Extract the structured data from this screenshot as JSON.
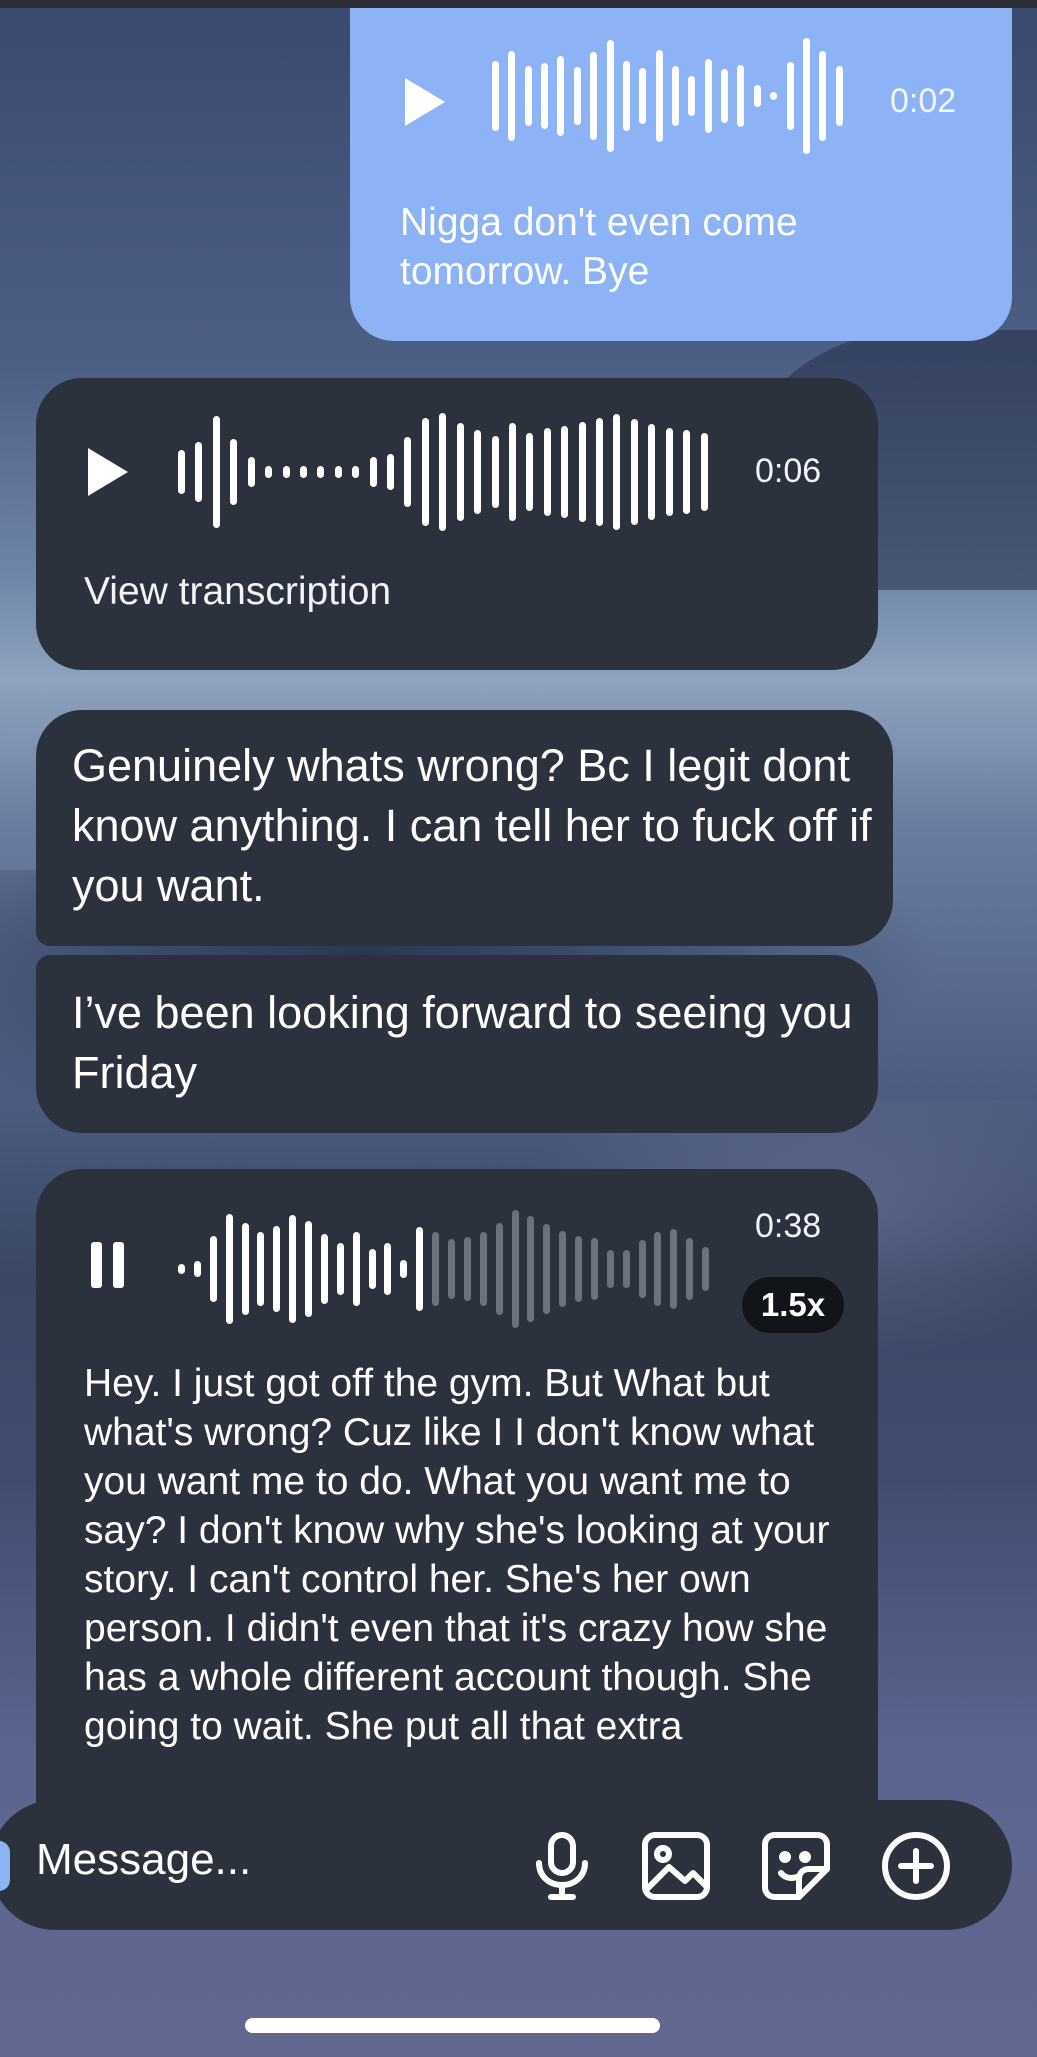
{
  "messages": [
    {
      "type": "voice",
      "direction": "outgoing",
      "duration": "0:02",
      "transcript": "Nigga don't even come tomorrow. Bye"
    },
    {
      "type": "voice",
      "direction": "incoming",
      "duration": "0:06",
      "action": "View transcription"
    },
    {
      "type": "text",
      "direction": "incoming",
      "text": "Genuinely whats wrong? Bc I legit dont know anything. I can tell her to fuck off if you want."
    },
    {
      "type": "text",
      "direction": "incoming",
      "text": "I’ve been looking forward to seeing you Friday"
    },
    {
      "type": "voice",
      "direction": "incoming",
      "state": "playing",
      "duration": "0:38",
      "speed": "1.5x",
      "progress": 0.47,
      "transcript": "Hey. I just got off the gym. But What but what's wrong? Cuz like I I don't know what you want me to do. What you want me to say? I don't know why she's looking at your story. I can't control her. She's her own person. I didn't even that it's crazy how she has a whole different account though. She going to wait. She put all that extra"
    }
  ],
  "composer": {
    "placeholder": "Message...",
    "icons": [
      "microphone-icon",
      "image-icon",
      "sticker-icon",
      "plus-circle-icon"
    ]
  },
  "colors": {
    "outgoing_bubble": "#8db2f5",
    "incoming_bubble": "#2b313d"
  }
}
